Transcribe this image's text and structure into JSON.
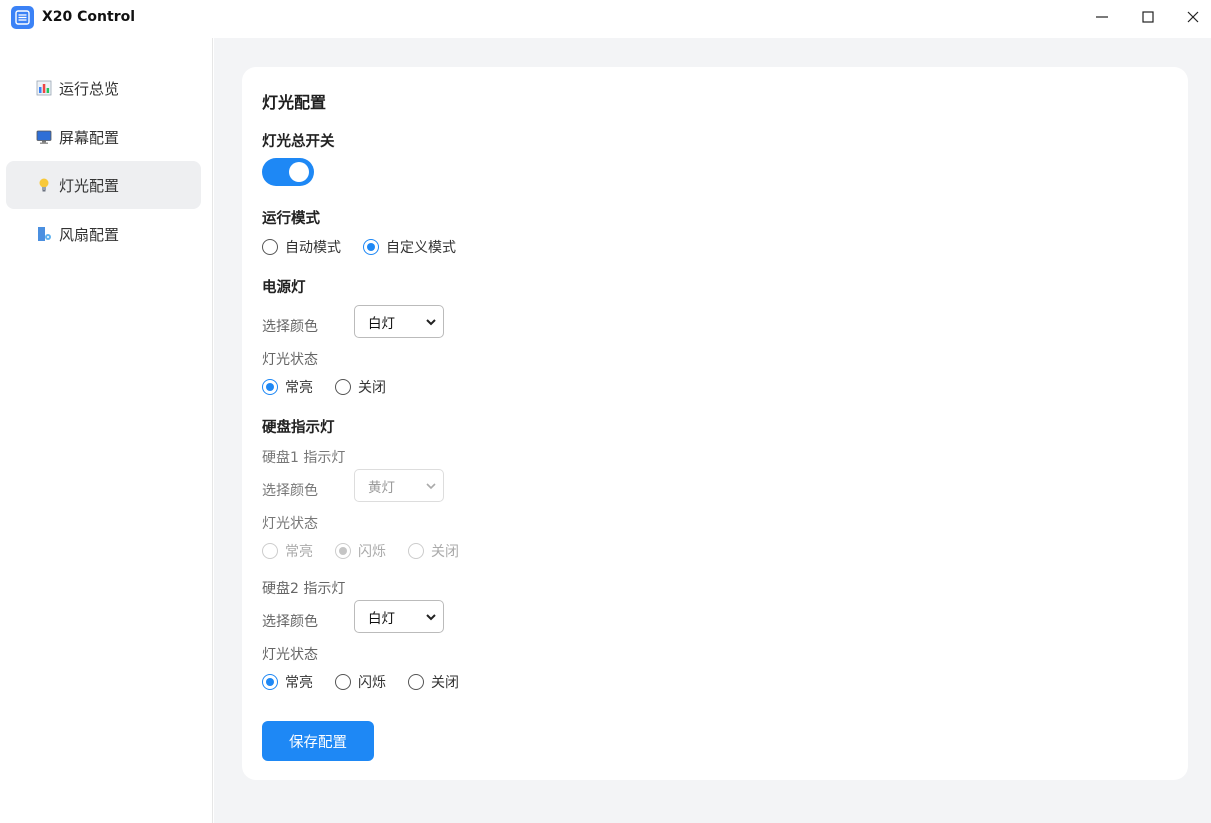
{
  "window": {
    "title": "X20 Control"
  },
  "sidebar": {
    "items": [
      {
        "label": "运行总览",
        "icon": "bar-chart-icon",
        "active": false
      },
      {
        "label": "屏幕配置",
        "icon": "monitor-icon",
        "active": false
      },
      {
        "label": "灯光配置",
        "icon": "lightbulb-icon",
        "active": true
      },
      {
        "label": "风扇配置",
        "icon": "fan-icon",
        "active": false
      }
    ]
  },
  "card": {
    "title": "灯光配置",
    "master_switch": {
      "label": "灯光总开关",
      "on": true
    },
    "run_mode": {
      "label": "运行模式",
      "options": [
        "自动模式",
        "自定义模式"
      ],
      "selected": "自定义模式"
    },
    "power_light": {
      "label": "电源灯",
      "color_label": "选择颜色",
      "color_value": "白灯",
      "state_label": "灯光状态",
      "options": [
        "常亮",
        "关闭"
      ],
      "selected": "常亮"
    },
    "disk_lights": {
      "label": "硬盘指示灯",
      "disk1": {
        "label": "硬盘1 指示灯",
        "color_label": "选择颜色",
        "color_value": "黄灯",
        "state_label": "灯光状态",
        "options": [
          "常亮",
          "闪烁",
          "关闭"
        ],
        "selected": "闪烁",
        "disabled": true
      },
      "disk2": {
        "label": "硬盘2 指示灯",
        "color_label": "选择颜色",
        "color_value": "白灯",
        "state_label": "灯光状态",
        "options": [
          "常亮",
          "闪烁",
          "关闭"
        ],
        "selected": "常亮",
        "disabled": false
      }
    },
    "save_label": "保存配置"
  },
  "colors": {
    "accent": "#1e88f5",
    "main_bg": "#f3f4f6",
    "active_nav_bg": "#eeeff1"
  }
}
